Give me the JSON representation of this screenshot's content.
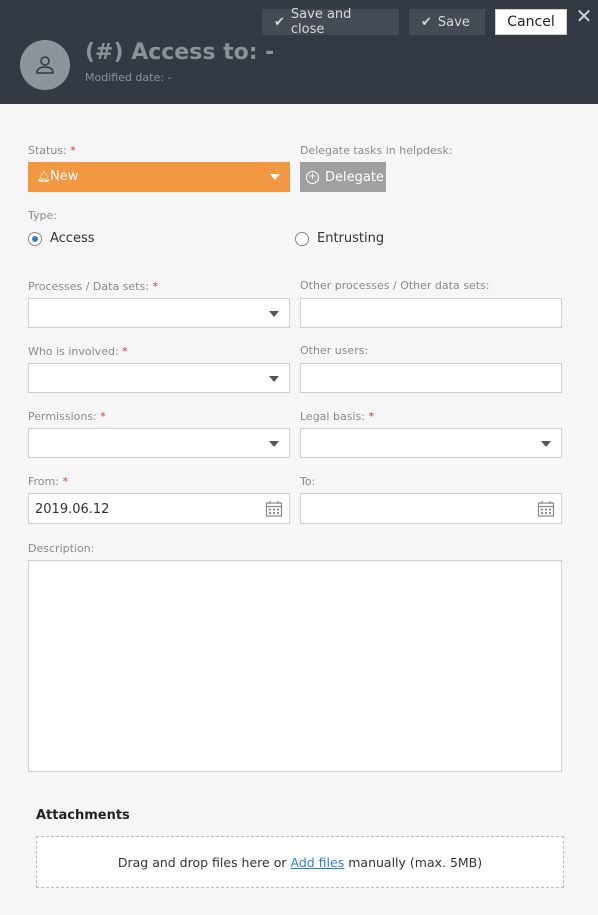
{
  "header": {
    "title": "(#) Access to: -",
    "modified_label": "Modified date: -",
    "save_close_label": "Save and close",
    "save_label": "Save",
    "cancel_label": "Cancel",
    "close_glyph": "✕"
  },
  "status": {
    "label": "Status:",
    "value": "New",
    "color": "#f29742"
  },
  "delegate": {
    "label": "Delegate tasks in helpdesk:",
    "button_label": "Delegate"
  },
  "type": {
    "label": "Type:",
    "options": [
      {
        "label": "Access",
        "selected": true
      },
      {
        "label": "Entrusting",
        "selected": false
      }
    ]
  },
  "fields": {
    "processes_label": "Processes / Data sets:",
    "other_processes_label": "Other processes / Other data sets:",
    "who_label": "Who is involved:",
    "other_users_label": "Other users:",
    "permissions_label": "Permissions:",
    "legal_label": "Legal basis:",
    "from_label": "From:",
    "from_value": "2019.06.12",
    "to_label": "To:",
    "description_label": "Description:"
  },
  "required_mark": "*",
  "attachments": {
    "title": "Attachments",
    "drop_prefix": "Drag and drop files here or",
    "add_link": "Add files",
    "drop_suffix": "manually (max. 5MB)"
  },
  "icons": [
    "check-icon",
    "close-icon",
    "user-icon",
    "bell-icon",
    "caret-down-icon",
    "plus-circle-icon",
    "calendar-icon"
  ]
}
